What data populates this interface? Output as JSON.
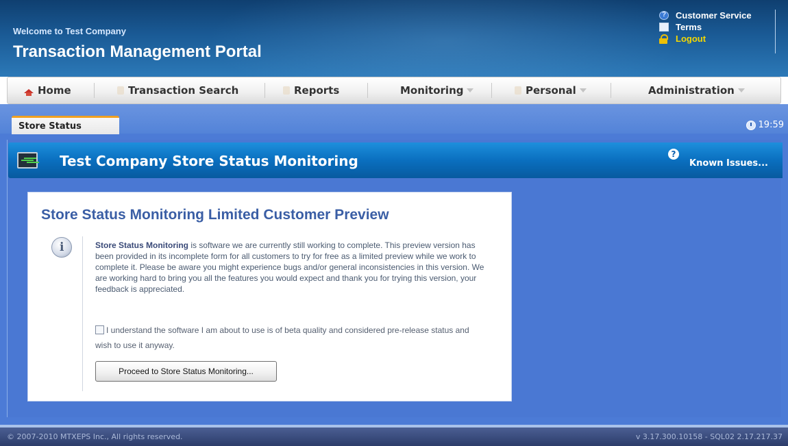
{
  "header": {
    "welcome": "Welcome to Test Company",
    "title": "Transaction Management Portal",
    "links": {
      "customer_service": "Customer Service",
      "terms": "Terms",
      "logout": "Logout"
    }
  },
  "nav": {
    "home": "Home",
    "transaction_search": "Transaction Search",
    "reports": "Reports",
    "monitoring": "Monitoring",
    "personal": "Personal",
    "administration": "Administration"
  },
  "tabs": {
    "active": "Store Status",
    "clock": "19:59"
  },
  "panel": {
    "title": "Test Company Store Status Monitoring",
    "known_issues": "Known Issues..."
  },
  "notice": {
    "title": "Store Status Monitoring Limited Customer Preview",
    "product_name": "Store Status Monitoring",
    "body": " is software we are currently still working to complete. This preview version has been provided in its incomplete form for all customers to try for free as a limited preview while we work to complete it. Please be aware you might experience bugs and/or general inconsistencies in this version. We are working hard to bring you all the features you would expect and thank you for trying this version, your feedback is appreciated.",
    "consent": "I understand the software I am about to use is of beta quality and considered pre-release status and wish to use it anyway.",
    "consent_checked": false,
    "button": "Proceed to Store Status Monitoring..."
  },
  "footer": {
    "copyright": "© 2007-2010 MTXEPS Inc., All rights reserved.",
    "version": "v 3.17.300.10158 - SQL02 2.17.217.37"
  },
  "colors": {
    "header_bg": "#1a5a95",
    "content_bg": "#4c7bd6",
    "title_bar": "#0a6fbf",
    "tab_accent": "#f0a020",
    "notice_title": "#3a5ea5",
    "logout": "#f5d800"
  }
}
